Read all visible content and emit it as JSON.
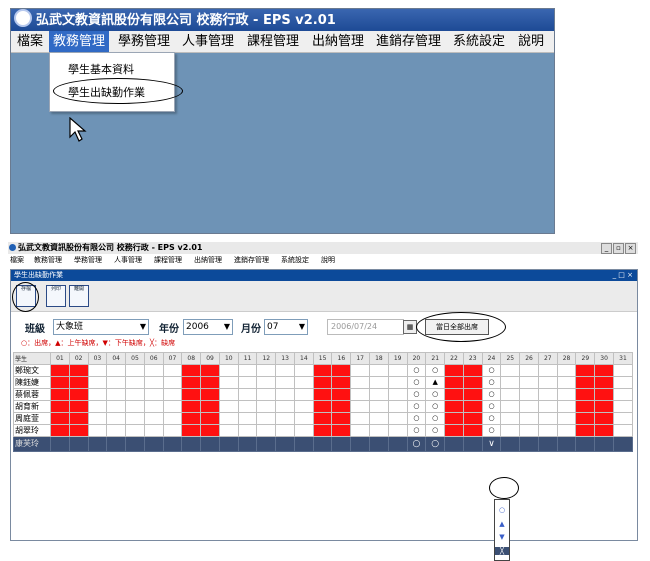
{
  "app_title": "弘武文教資訊股份有限公司 校務行政 - EPS v2.01",
  "menu": [
    "檔案",
    "教務管理",
    "學務管理",
    "人事管理",
    "課程管理",
    "出納管理",
    "進銷存管理",
    "系統設定",
    "說明"
  ],
  "dropdown_items": [
    "學生基本資料",
    "學生出缺勤作業"
  ],
  "child_window_title": "學生出缺勤作業",
  "toolbar_buttons": [
    "存檔",
    "列印",
    "離開"
  ],
  "filters": {
    "class_label": "班級",
    "class_value": "大象班",
    "year_label": "年份",
    "year_value": "2006",
    "month_label": "月份",
    "month_value": "07",
    "date_value": "2006/07/24",
    "import_button": "當日全部出席"
  },
  "legend": "○：出席，▲：上午缺席，▼：下午缺席，╳：缺席",
  "grid": {
    "header_name": "學生",
    "days": [
      "01",
      "02",
      "03",
      "04",
      "05",
      "06",
      "07",
      "08",
      "09",
      "10",
      "11",
      "12",
      "13",
      "14",
      "15",
      "16",
      "17",
      "18",
      "19",
      "20",
      "21",
      "22",
      "23",
      "24",
      "25",
      "26",
      "27",
      "28",
      "29",
      "30",
      "31"
    ],
    "holiday_days": [
      "01",
      "02",
      "08",
      "09",
      "15",
      "16",
      "22",
      "23",
      "29",
      "30"
    ],
    "students": [
      {
        "name": "鄭琬文",
        "marks": {
          "20": "○",
          "21": "○",
          "24": "○"
        }
      },
      {
        "name": "陳鈺婕",
        "marks": {
          "20": "○",
          "21": "▲",
          "24": "○"
        }
      },
      {
        "name": "蔡佩蓉",
        "marks": {
          "20": "○",
          "21": "○",
          "24": "○"
        }
      },
      {
        "name": "胡育新",
        "marks": {
          "20": "○",
          "21": "○",
          "24": "○"
        }
      },
      {
        "name": "周庭萱",
        "marks": {
          "20": "○",
          "21": "○",
          "24": "○"
        }
      },
      {
        "name": "胡翠玲",
        "marks": {
          "20": "○",
          "21": "○",
          "24": "○"
        }
      },
      {
        "name": "康芙玲",
        "marks": {
          "20": "○",
          "21": "○",
          "24": "∨"
        }
      }
    ],
    "selected_row": 6
  },
  "cell_dropdown_options": [
    "○",
    "▲",
    "▼",
    "╳"
  ],
  "colors": {
    "holiday": "#ff1111",
    "title_bar": "#1d4a95",
    "selected_row": "#3b4f73"
  }
}
